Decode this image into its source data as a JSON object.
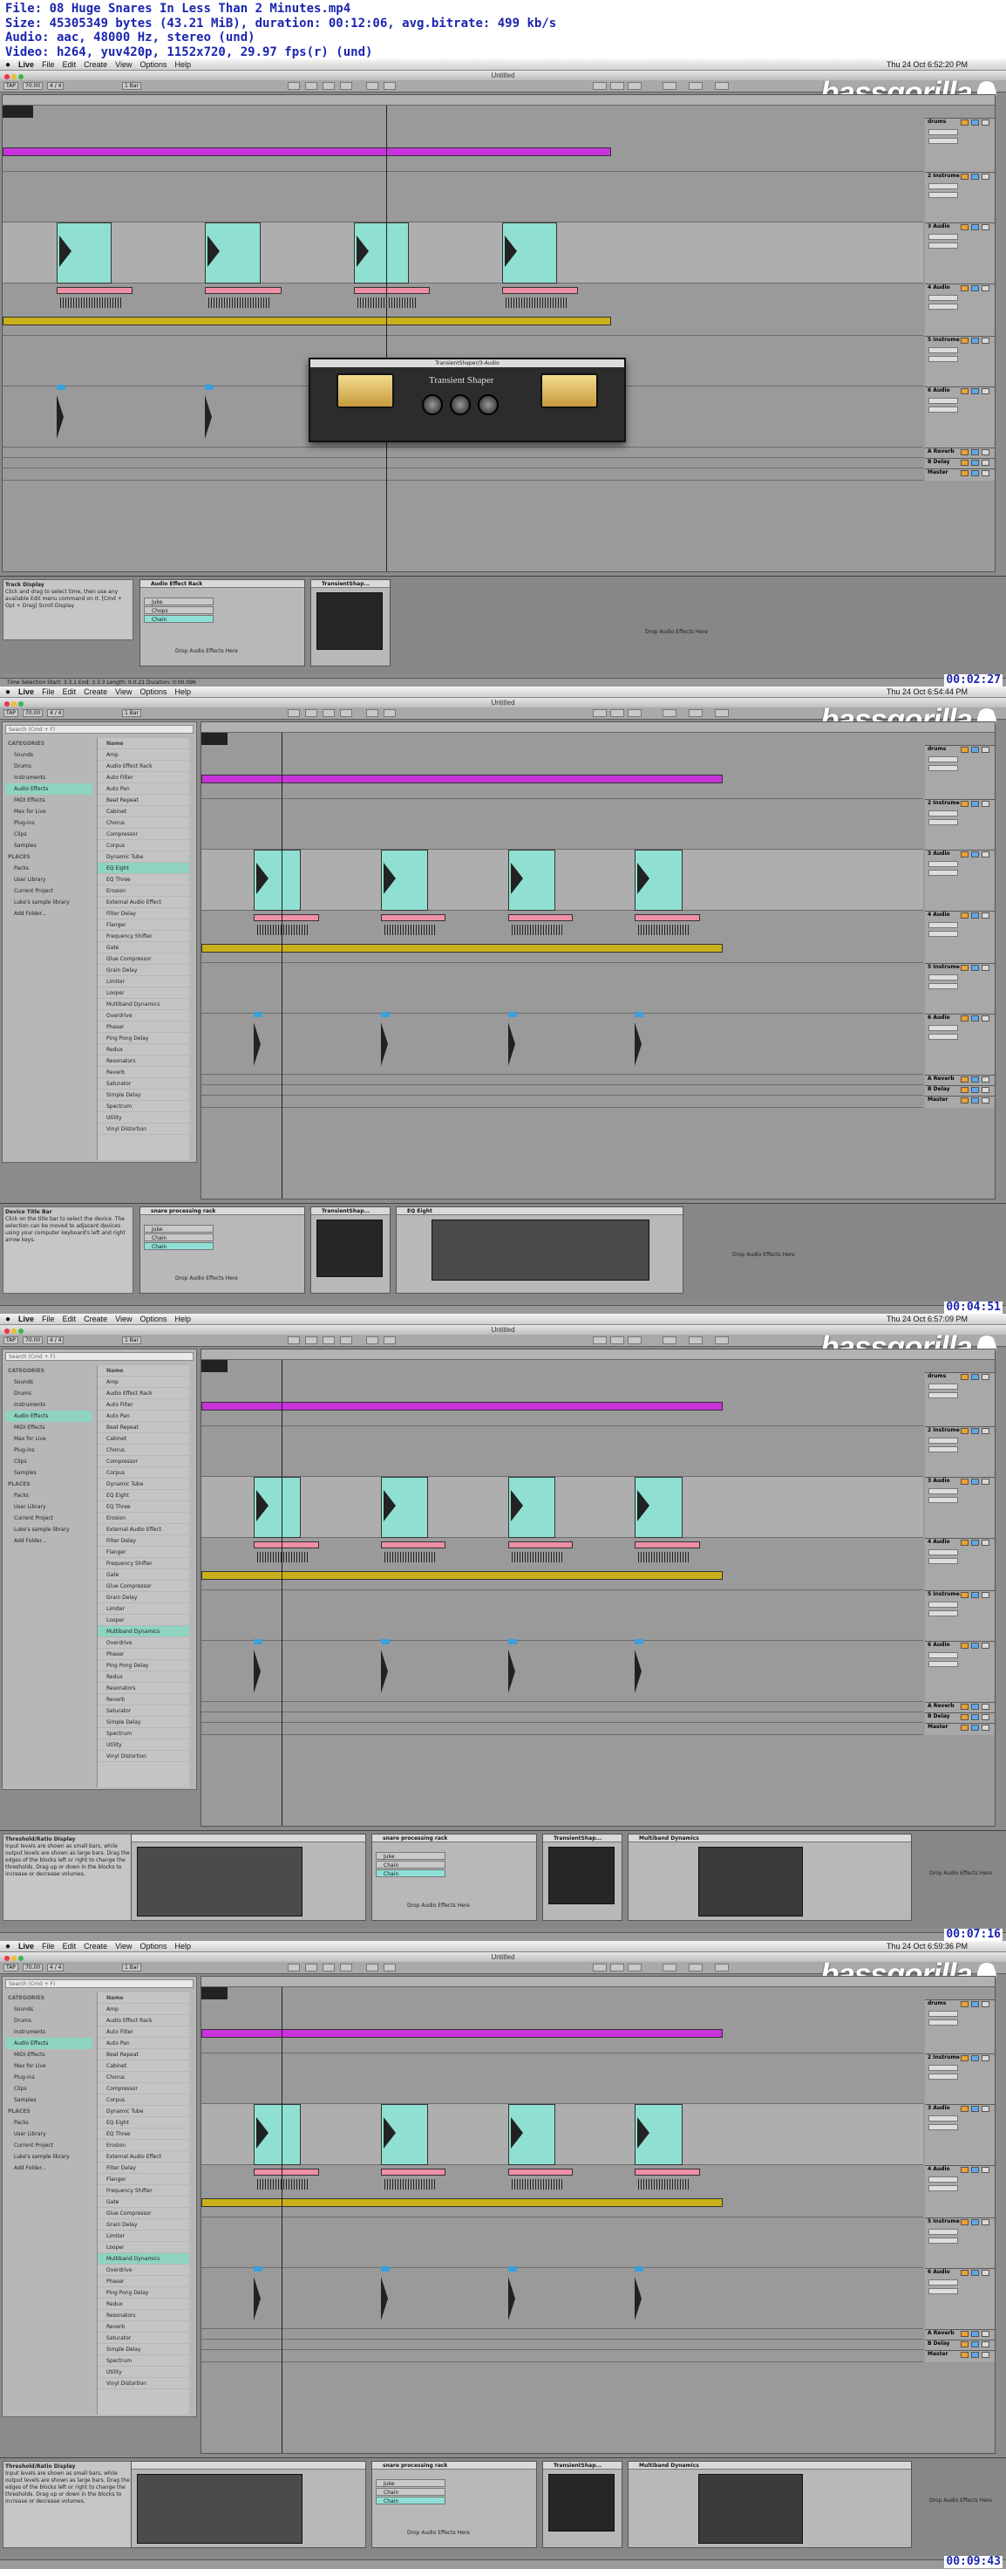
{
  "header": {
    "file": "File: 08 Huge Snares In Less Than 2 Minutes.mp4",
    "size": "Size: 45305349 bytes (43.21 MiB), duration: 00:12:06, avg.bitrate: 499 kb/s",
    "audio": "Audio: aac, 48000 Hz, stereo (und)",
    "video": "Video: h264, yuv420p, 1152x720, 29.97 fps(r) (und)"
  },
  "menubar": {
    "app": "Live",
    "items": [
      "File",
      "Edit",
      "Create",
      "View",
      "Options",
      "Help"
    ]
  },
  "window_title": "Untitled",
  "logo": "bassgorilla",
  "transport": {
    "tap": "TAP",
    "tempo": "70.00",
    "sig": "4 / 4",
    "quant": "1 Bar"
  },
  "colors": {
    "purple": "#c833dc",
    "yellow": "#c9b01a",
    "teal": "#8fe0d2",
    "pink": "#ee8fa6",
    "blue_label": "#3aa0dc"
  },
  "frames": [
    {
      "clock": "Thu 24 Oct  6:52:20 PM",
      "timecode": "00:02:27",
      "tracks": [
        "drums",
        "2 Instrume",
        "3 Audio",
        "4 Audio",
        "5 Instrume",
        "6 Audio",
        "A Reverb",
        "B Delay",
        "Master"
      ],
      "info_title": "Track Display",
      "info_text": "Click and drag to select time, then use any available Edit menu command on it. [Cmd + Opt + Drag] Scroll Display",
      "devices": [
        "Audio Effect Rack",
        "TransientShap..."
      ],
      "chains": [
        "Juke",
        "Chops",
        "Chain"
      ],
      "drop_text": "Drop Audio Effects Here",
      "plugin_title": "TransientShaper/3-Audio",
      "plugin_name": "Transient Shaper",
      "status": "Time Selection   Start: 3.3.1   End: 3.3.3   Length: 0.0.21   Duration: 0:00.096"
    },
    {
      "clock": "Thu 24 Oct  6:54:44 PM",
      "timecode": "00:04:51",
      "tracks": [
        "drums",
        "2 Instrume",
        "3 Audio",
        "4 Audio",
        "5 Instrume",
        "6 Audio",
        "A Reverb",
        "B Delay",
        "Master"
      ],
      "info_title": "Device Title Bar",
      "info_text": "Click on the title bar to select the device. The selection can be moved to adjacent devices using your computer keyboard's left and right arrow keys.",
      "devices": [
        "snare processing rack",
        "TransientShap...",
        "EQ Eight"
      ],
      "chains": [
        "Juke",
        "Chain",
        "Chain"
      ],
      "drop_text": "Drop Audio Effects Here"
    },
    {
      "clock": "Thu 24 Oct  6:57:09 PM",
      "timecode": "00:07:16",
      "tracks": [
        "drums",
        "2 Instrume",
        "3 Audio",
        "4 Audio",
        "5 Instrume",
        "6 Audio",
        "A Reverb",
        "B Delay",
        "Master"
      ],
      "info_title": "Threshold/Ratio Display",
      "info_text": "Input levels are shown as small bars, while output levels are shown as large bars. Drag the edges of the blocks left or right to change the thresholds. Drag up or down in the blocks to increase or decrease volumes.",
      "devices": [
        "snare processing rack",
        "TransientShap...",
        "Multiband Dynamics"
      ],
      "chains": [
        "Juke",
        "Chain",
        "Chain"
      ],
      "drop_text": "Drop Audio Effects Here"
    },
    {
      "clock": "Thu 24 Oct  6:59:36 PM",
      "timecode": "00:09:43",
      "tracks": [
        "drums",
        "2 Instrume",
        "3 Audio",
        "4 Audio",
        "5 Instrume",
        "6 Audio",
        "A Reverb",
        "B Delay",
        "Master"
      ],
      "info_title": "Threshold/Ratio Display",
      "info_text": "Input levels are shown as small bars, while output levels are shown as large bars. Drag the edges of the blocks left or right to change the thresholds. Drag up or down in the blocks to increase or decrease volumes.",
      "devices": [
        "snare processing rack",
        "TransientShap...",
        "Multiband Dynamics"
      ],
      "chains": [
        "Juke",
        "Chain",
        "Chain"
      ],
      "drop_text": "Drop Audio Effects Here"
    }
  ],
  "browser": {
    "search": "Search (Cmd + F)",
    "categories_label": "CATEGORIES",
    "categories": [
      "Sounds",
      "Drums",
      "Instruments",
      "Audio Effects",
      "MIDI Effects",
      "Max for Live",
      "Plug-ins",
      "Clips",
      "Samples"
    ],
    "places_label": "PLACES",
    "places": [
      "Packs",
      "User Library",
      "Current Project",
      "Luke's sample library",
      "Add Folder..."
    ],
    "names_header": "Name",
    "names": [
      "Amp",
      "Audio Effect Rack",
      "Auto Filter",
      "Auto Pan",
      "Beat Repeat",
      "Cabinet",
      "Chorus",
      "Compressor",
      "Corpus",
      "Dynamic Tube",
      "EQ Eight",
      "EQ Three",
      "Erosion",
      "External Audio Effect",
      "Filter Delay",
      "Flanger",
      "Frequency Shifter",
      "Gate",
      "Glue Compressor",
      "Grain Delay",
      "Limiter",
      "Looper",
      "Multiband Dynamics",
      "Overdrive",
      "Phaser",
      "Ping Pong Delay",
      "Redux",
      "Resonators",
      "Reverb",
      "Saturator",
      "Simple Delay",
      "Spectrum",
      "Utility",
      "Vinyl Distortion"
    ]
  }
}
